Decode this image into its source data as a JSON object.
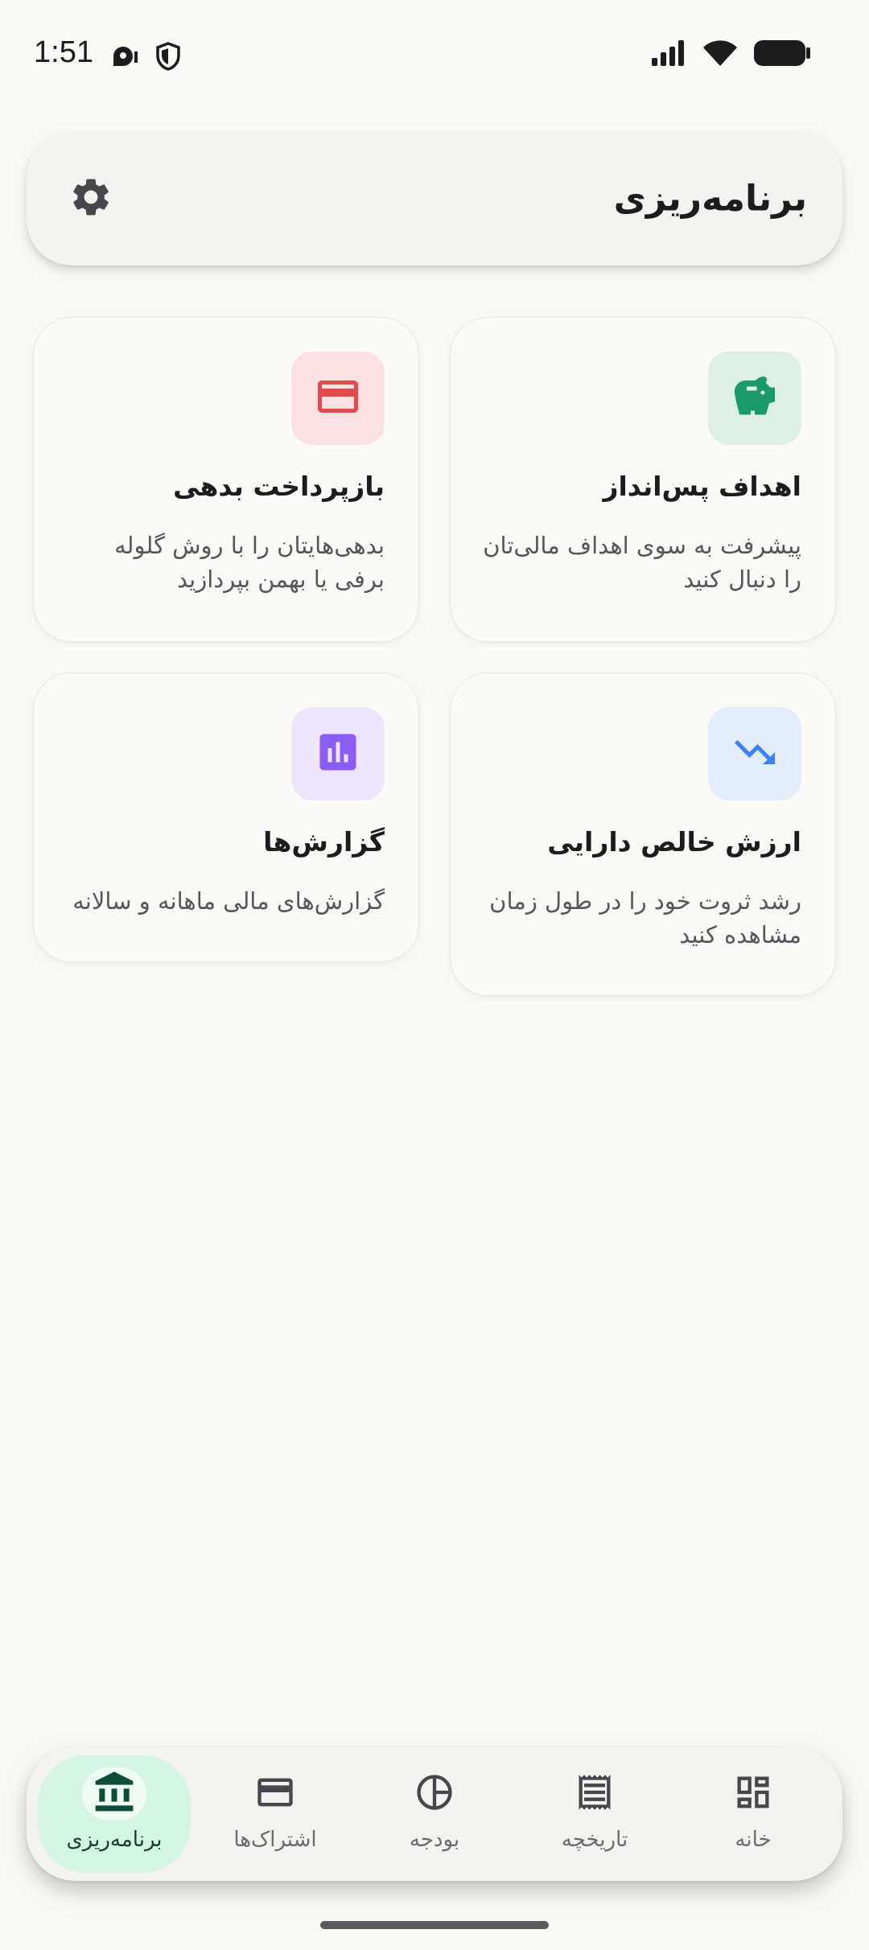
{
  "status_bar": {
    "time": "1:51"
  },
  "header": {
    "title": "برنامه‌ریزی",
    "settings_icon": "gear-icon"
  },
  "cards": [
    {
      "id": "savings",
      "title": "اهداف پس‌انداز",
      "description": "پیشرفت به سوی اهداف مالی‌تان را دنبال کنید",
      "icon": "piggy-bank-icon",
      "icon_color": "#1a9a6a",
      "icon_bg": "#ddf0e6"
    },
    {
      "id": "debt",
      "title": "بازپرداخت بدهی",
      "description": "بدهی‌هایتان را با روش گلوله برفی یا بهمن بپردازید",
      "icon": "credit-card-icon",
      "icon_color": "#e5484d",
      "icon_bg": "#fbe1e1"
    },
    {
      "id": "networth",
      "title": "ارزش خالص دارایی",
      "description": "رشد ثروت خود را در طول زمان مشاهده کنید",
      "icon": "trending-up-icon",
      "icon_color": "#3b82f6",
      "icon_bg": "#e3ecfb"
    },
    {
      "id": "reports",
      "title": "گزارش‌ها",
      "description": "گزارش‌های مالی ماهانه و سالانه",
      "icon": "bar-chart-icon",
      "icon_color": "#8b5cf6",
      "icon_bg": "#ece5fb"
    }
  ],
  "bottom_nav": {
    "items": [
      {
        "label": "خانه",
        "icon": "dashboard-icon",
        "active": false
      },
      {
        "label": "تاریخچه",
        "icon": "receipt-icon",
        "active": false
      },
      {
        "label": "بودجه",
        "icon": "pie-chart-icon",
        "active": false
      },
      {
        "label": "اشتراک‌ها",
        "icon": "credit-card-icon",
        "active": false
      },
      {
        "label": "برنامه‌ریزی",
        "icon": "bank-icon",
        "active": true
      }
    ]
  },
  "colors": {
    "background": "#faf9f6",
    "active_nav_bg": "#d4f5e2",
    "active_nav_icon": "#0f4d3a"
  }
}
